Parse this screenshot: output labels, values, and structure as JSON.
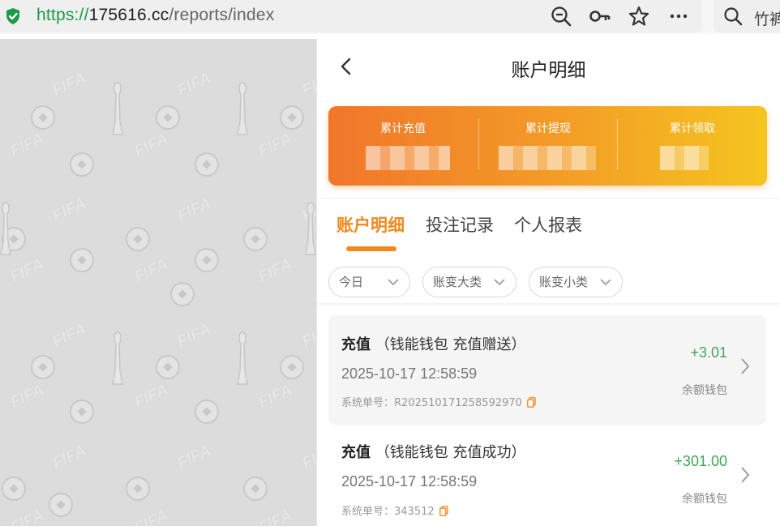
{
  "browser": {
    "url_scheme": "https://",
    "url_host": "175616.cc",
    "url_path": "/reports/index",
    "search_text": "竹裤"
  },
  "pattern": {
    "watermark_text": "FIFA"
  },
  "page": {
    "title": "账户明细"
  },
  "summary": {
    "items": [
      {
        "label": "累计充值"
      },
      {
        "label": "累计提现"
      },
      {
        "label": "累计领取"
      }
    ],
    "gradient_colors": [
      "#f1762a",
      "#f4c51f"
    ]
  },
  "tabs": [
    {
      "label": "账户明细",
      "active": true
    },
    {
      "label": "投注记录",
      "active": false
    },
    {
      "label": "个人报表",
      "active": false
    }
  ],
  "filters": [
    {
      "label": "今日"
    },
    {
      "label": "账变大类"
    },
    {
      "label": "账变小类"
    }
  ],
  "records": [
    {
      "type": "充值",
      "detail": "（钱能钱包 充值赠送）",
      "time": "2025-10-17 12:58:59",
      "order_label": "系统单号：",
      "order_no": "R202510171258592970",
      "amount": "+3.01",
      "wallet": "余额钱包"
    },
    {
      "type": "充值",
      "detail": "（钱能钱包 充值成功）",
      "time": "2025-10-17 12:58:59",
      "order_label": "系统单号：",
      "order_no": "343512",
      "amount": "+301.00",
      "wallet": "余额钱包"
    }
  ],
  "colors": {
    "accent": "#f1891f",
    "positive": "#41a656"
  }
}
